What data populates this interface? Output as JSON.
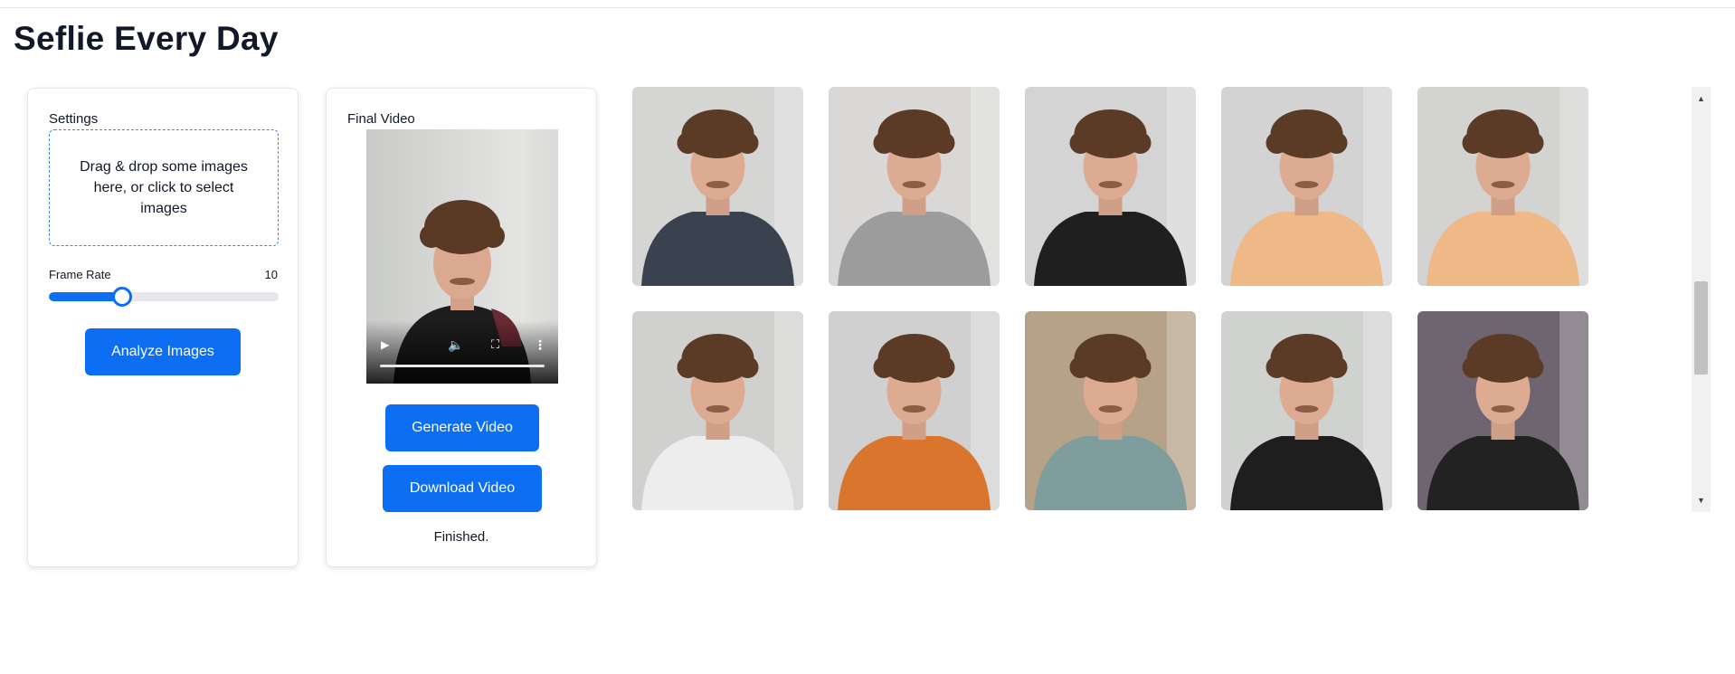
{
  "page": {
    "title": "Seflie Every Day"
  },
  "settings": {
    "label": "Settings",
    "dropzone_text": "Drag & drop some images here, or click to select images",
    "frame_rate_label": "Frame Rate",
    "frame_rate_value": "10",
    "frame_rate_fraction": 0.32,
    "analyze_label": "Analyze Images"
  },
  "video": {
    "label": "Final Video",
    "generate_label": "Generate Video",
    "download_label": "Download Video",
    "status": "Finished.",
    "controls": {
      "play_icon": "play-icon",
      "volume_icon": "volume-muted-icon",
      "fullscreen_icon": "fullscreen-icon",
      "menu_icon": "more-vert-icon"
    }
  },
  "gallery": {
    "images": [
      {
        "shirt": "#3a414f",
        "bg": "#d5d6d4"
      },
      {
        "shirt": "#9c9c9c",
        "bg": "#d9d8d6"
      },
      {
        "shirt": "#1f1f1f",
        "bg": "#d3d4d3"
      },
      {
        "shirt": "#efb887",
        "bg": "#d2d3d2"
      },
      {
        "shirt": "#eeb887",
        "bg": "#d3d3d1"
      },
      {
        "shirt": "#ededed",
        "bg": "#d0d1cf"
      },
      {
        "shirt": "#d9752c",
        "bg": "#cfd0cf"
      },
      {
        "shirt": "#7e9d9c",
        "bg": "#b6a288"
      },
      {
        "shirt": "#1e1e1e",
        "bg": "#d0d2d0"
      },
      {
        "shirt": "#222222",
        "bg": "#6f6570"
      }
    ]
  },
  "colors": {
    "accent": "#0b6ef3",
    "title": "#111827"
  }
}
